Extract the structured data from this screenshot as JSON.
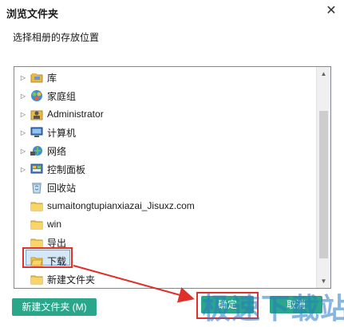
{
  "window": {
    "title": "浏览文件夹",
    "close_glyph": "✕"
  },
  "subtitle": "选择相册的存放位置",
  "tree": {
    "items": [
      {
        "label": "库",
        "icon": "library-icon",
        "expandable": true
      },
      {
        "label": "家庭组",
        "icon": "homegroup-icon",
        "expandable": true
      },
      {
        "label": "Administrator",
        "icon": "user-folder-icon",
        "expandable": true
      },
      {
        "label": "计算机",
        "icon": "computer-icon",
        "expandable": true
      },
      {
        "label": "网络",
        "icon": "network-icon",
        "expandable": true
      },
      {
        "label": "控制面板",
        "icon": "control-panel-icon",
        "expandable": true
      },
      {
        "label": "回收站",
        "icon": "recycle-bin-icon",
        "expandable": false
      },
      {
        "label": "sumaitongtupianxiazai_Jisuxz.com",
        "icon": "folder-icon",
        "expandable": false
      },
      {
        "label": "win",
        "icon": "folder-icon",
        "expandable": false
      },
      {
        "label": "导出",
        "icon": "folder-icon",
        "expandable": false
      },
      {
        "label": "下载",
        "icon": "folder-open-icon",
        "expandable": false,
        "selected": true
      },
      {
        "label": "新建文件夹",
        "icon": "folder-icon",
        "expandable": false
      }
    ]
  },
  "buttons": {
    "new_folder": "新建文件夹 (M)",
    "ok": "确定",
    "cancel": "取消"
  },
  "watermark": "极速下载站",
  "colors": {
    "button": "#2aa68a",
    "highlight_border": "#e0302b",
    "selection_fill": "#d5e8f8",
    "watermark": "#2878c8"
  }
}
